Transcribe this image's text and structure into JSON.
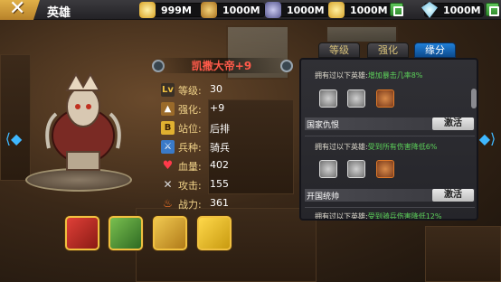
{
  "header": {
    "close_icon": "close-x-icon",
    "title": "英雄"
  },
  "resources": [
    {
      "value": "999M",
      "icon": "gold-coin-icon",
      "color": "#f0c040"
    },
    {
      "value": "1000M",
      "icon": "ore-icon",
      "color": "#d8a030"
    },
    {
      "value": "1000M",
      "icon": "crystal-icon",
      "color": "#7a7ab8"
    },
    {
      "value": "1000M",
      "icon": "gold-ingot-icon",
      "color": "#f2c84a"
    },
    {
      "value": "1000M",
      "icon": "diamond-icon",
      "color": "#9fe3ff"
    }
  ],
  "hero": {
    "name": "凯撒大帝+9",
    "name_color": "#ff5a4a",
    "stats": [
      {
        "icon": "lv-icon",
        "label": "等级:",
        "value": "30"
      },
      {
        "icon": "enhance-icon",
        "label": "强化:",
        "value": "+9"
      },
      {
        "icon": "position-icon",
        "label": "站位:",
        "value": "后排"
      },
      {
        "icon": "unit-type-icon",
        "label": "兵种:",
        "value": "骑兵"
      },
      {
        "icon": "heart-icon",
        "label": "血量:",
        "value": "402"
      },
      {
        "icon": "swords-icon",
        "label": "攻击:",
        "value": "155"
      },
      {
        "icon": "fire-icon",
        "label": "战力:",
        "value": "361"
      }
    ]
  },
  "skills": [
    "skill-beast-icon",
    "skill-tower-icon",
    "skill-bone-icon",
    "skill-bear-icon"
  ],
  "tabs": [
    {
      "label": "等级",
      "active": false
    },
    {
      "label": "强化",
      "active": false
    },
    {
      "label": "缘分",
      "active": true
    }
  ],
  "fates": [
    {
      "prefix": "拥有过以下英雄:",
      "effect": "增加暴击几率8%",
      "name": "国家仇恨",
      "button": "激活"
    },
    {
      "prefix": "拥有过以下英雄:",
      "effect": "受到所有伤害降低6%",
      "name": "开国统帅",
      "button": "激活"
    },
    {
      "prefix": "拥有过以下英雄:",
      "effect": "受到骑兵伤害降低12%"
    }
  ]
}
